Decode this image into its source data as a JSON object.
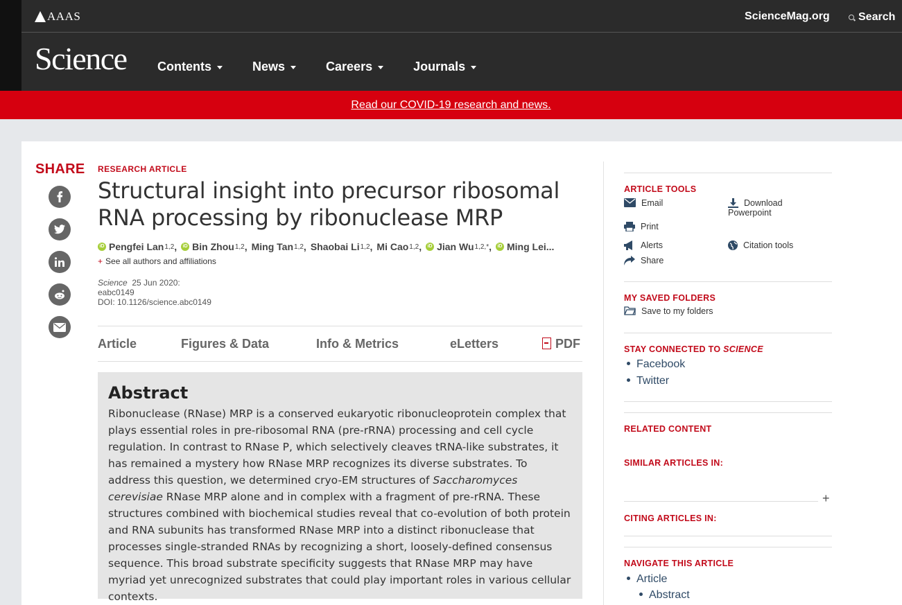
{
  "header": {
    "org": "AAAS",
    "site_link": "ScienceMag.org",
    "search_label": "Search",
    "brand": "Science",
    "nav": [
      {
        "label": "Contents"
      },
      {
        "label": "News"
      },
      {
        "label": "Careers"
      },
      {
        "label": "Journals"
      }
    ]
  },
  "banner": {
    "text": "Read our COVID-19 research and news."
  },
  "share": {
    "label": "SHARE",
    "buttons": [
      "facebook-icon",
      "twitter-icon",
      "linkedin-icon",
      "reddit-icon",
      "email-icon"
    ]
  },
  "article": {
    "kicker": "RESEARCH ARTICLE",
    "title": "Structural insight into precursor ribosomal RNA processing by ribonuclease MRP",
    "authors": [
      {
        "name": "Pengfei Lan",
        "sup": "1,2",
        "orcid": true
      },
      {
        "name": "Bin Zhou",
        "sup": "1,2",
        "orcid": true
      },
      {
        "name": "Ming Tan",
        "sup": "1,2",
        "orcid": false
      },
      {
        "name": "Shaobai Li",
        "sup": "1,2",
        "orcid": false
      },
      {
        "name": "Mi Cao",
        "sup": "1,2",
        "orcid": false
      },
      {
        "name": "Jian Wu",
        "sup": "1,2,*",
        "orcid": true
      },
      {
        "name": "Ming Lei...",
        "sup": "",
        "orcid": true
      }
    ],
    "see_all": "See all authors and affiliations",
    "journal": "Science",
    "date": "25 Jun 2020:",
    "article_id": "eabc0149",
    "doi": "DOI: 10.1126/science.abc0149"
  },
  "tabs": {
    "article": "Article",
    "figures": "Figures & Data",
    "info": "Info & Metrics",
    "eletters": "eLetters",
    "pdf": "PDF"
  },
  "abstract": {
    "heading": "Abstract",
    "text_before": "Ribonuclease (RNase) MRP is a conserved eukaryotic ribonucleoprotein complex that plays essential roles in pre-ribosomal RNA (pre-rRNA) processing and cell cycle regulation. In contrast to RNase P, which selectively cleaves tRNA-like substrates, it has remained a mystery how RNase MRP recognizes its diverse substrates. To address this question, we determined cryo-EM structures of ",
    "species": "Saccharomyces cerevisiae",
    "text_after": " RNase MRP alone and in complex with a fragment of pre-rRNA. These structures combined with biochemical studies reveal that co-evolution of both protein and RNA subunits has transformed RNase MRP into a distinct ribonuclease that processes single-stranded RNAs by recognizing a short, loosely-defined consensus sequence. This broad substrate specificity suggests that RNase MRP may have myriad yet unrecognized substrates that could play important roles in various cellular contexts."
  },
  "sidebar": {
    "tools_heading": "ARTICLE TOOLS",
    "tools": {
      "email": "Email",
      "download_line1": "Download",
      "download_line2": "Powerpoint",
      "print": "Print",
      "alerts": "Alerts",
      "citation": "Citation tools",
      "share": "Share"
    },
    "folders_heading": "MY SAVED FOLDERS",
    "save_folders": "Save to my folders",
    "stay_heading": "STAY CONNECTED TO",
    "stay_heading_em": "SCIENCE",
    "stay_links": [
      "Facebook",
      "Twitter"
    ],
    "related_heading": "RELATED CONTENT",
    "similar_heading": "SIMILAR ARTICLES IN:",
    "citing_heading": "CITING ARTICLES IN:",
    "navigate_heading": "NAVIGATE THIS ARTICLE",
    "navigate_links": [
      "Article",
      "Abstract"
    ]
  },
  "colors": {
    "brand_red": "#c20a1a",
    "banner_red": "#d6000f",
    "header_dark": "#2b2b2b",
    "link_blue": "#2f4a66"
  }
}
